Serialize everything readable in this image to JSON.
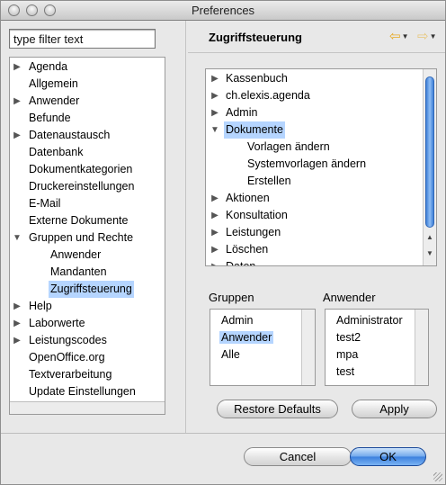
{
  "window": {
    "title": "Preferences"
  },
  "filter": {
    "value": "type filter text"
  },
  "nav": {
    "items": [
      {
        "label": "Agenda",
        "arrow": "▶",
        "indent": 0
      },
      {
        "label": "Allgemein",
        "arrow": "",
        "indent": 0
      },
      {
        "label": "Anwender",
        "arrow": "▶",
        "indent": 0
      },
      {
        "label": "Befunde",
        "arrow": "",
        "indent": 0
      },
      {
        "label": "Datenaustausch",
        "arrow": "▶",
        "indent": 0
      },
      {
        "label": "Datenbank",
        "arrow": "",
        "indent": 0
      },
      {
        "label": "Dokumentkategorien",
        "arrow": "",
        "indent": 0
      },
      {
        "label": "Druckereinstellungen",
        "arrow": "",
        "indent": 0
      },
      {
        "label": "E-Mail",
        "arrow": "",
        "indent": 0
      },
      {
        "label": "Externe Dokumente",
        "arrow": "",
        "indent": 0
      },
      {
        "label": "Gruppen und Rechte",
        "arrow": "▼",
        "indent": 0
      },
      {
        "label": "Anwender",
        "arrow": "",
        "indent": 1
      },
      {
        "label": "Mandanten",
        "arrow": "",
        "indent": 1
      },
      {
        "label": "Zugriffsteuerung",
        "arrow": "",
        "indent": 1,
        "selected": true
      },
      {
        "label": "Help",
        "arrow": "▶",
        "indent": 0
      },
      {
        "label": "Laborwerte",
        "arrow": "▶",
        "indent": 0
      },
      {
        "label": "Leistungscodes",
        "arrow": "▶",
        "indent": 0
      },
      {
        "label": "OpenOffice.org",
        "arrow": "",
        "indent": 0
      },
      {
        "label": "Textverarbeitung",
        "arrow": "",
        "indent": 0
      },
      {
        "label": "Update Einstellungen",
        "arrow": "",
        "indent": 0
      }
    ]
  },
  "page": {
    "title": "Zugriffsteuerung",
    "back_icon": "back-arrow-icon",
    "forward_icon": "forward-arrow-icon"
  },
  "rights": {
    "items": [
      {
        "label": "Kassenbuch",
        "arrow": "▶",
        "indent": 0
      },
      {
        "label": "ch.elexis.agenda",
        "arrow": "▶",
        "indent": 0
      },
      {
        "label": "Admin",
        "arrow": "▶",
        "indent": 0
      },
      {
        "label": "Dokumente",
        "arrow": "▼",
        "indent": 0,
        "selected": true
      },
      {
        "label": "Vorlagen ändern",
        "arrow": "",
        "indent": 1
      },
      {
        "label": "Systemvorlagen ändern",
        "arrow": "",
        "indent": 1
      },
      {
        "label": "Erstellen",
        "arrow": "",
        "indent": 1
      },
      {
        "label": "Aktionen",
        "arrow": "▶",
        "indent": 0
      },
      {
        "label": "Konsultation",
        "arrow": "▶",
        "indent": 0
      },
      {
        "label": "Leistungen",
        "arrow": "▶",
        "indent": 0
      },
      {
        "label": "Löschen",
        "arrow": "▶",
        "indent": 0
      },
      {
        "label": "Daten",
        "arrow": "▶",
        "indent": 0
      }
    ]
  },
  "groups": {
    "label": "Gruppen",
    "items": [
      "Admin",
      "Anwender",
      "Alle"
    ],
    "selected": 1
  },
  "users": {
    "label": "Anwender",
    "items": [
      "Administrator",
      "test2",
      "mpa",
      "test"
    ]
  },
  "buttons": {
    "restore": "Restore Defaults",
    "apply": "Apply",
    "cancel": "Cancel",
    "ok": "OK"
  },
  "colors": {
    "selection": "#b5d5ff",
    "default_button": "#3b7fde",
    "back_arrow": "#e7a922"
  }
}
